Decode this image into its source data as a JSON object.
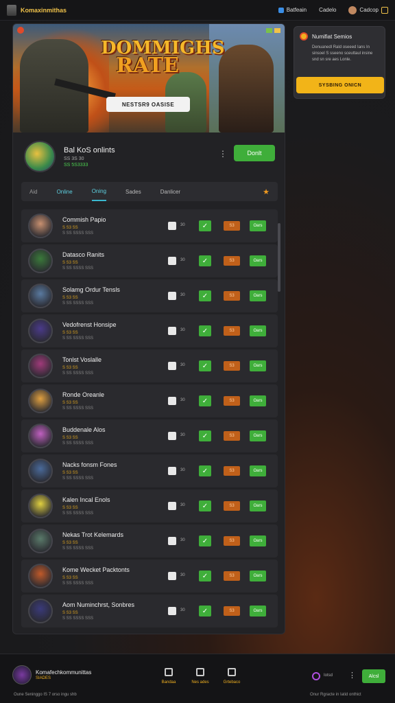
{
  "topbar": {
    "brand": "Komaxinmithas",
    "item1": "Batfeain",
    "item2": "Cadelo",
    "item3": "Cadcop"
  },
  "hero": {
    "title_line1": "DOMMIGHS",
    "title_line2": "RATE",
    "button": "NESTSR9 OASISE"
  },
  "profile": {
    "name": "Bal KoS onlints",
    "meta": "SS 3S 30",
    "stat": "SS 5S3333",
    "button": "Donlt"
  },
  "tabs": [
    "Aid",
    "Online",
    "Oning",
    "Sades",
    "Danlicer"
  ],
  "rows": [
    {
      "name": "Commish Papio",
      "sub": "S S3 SS",
      "sub2": "S SS SSSS SSS",
      "num": "30",
      "orange": "S3",
      "green": "Oars",
      "color": "#c89070"
    },
    {
      "name": "Datasco Ranits",
      "sub": "S S3 SS",
      "sub2": "S SS SSSS SSS",
      "num": "30",
      "orange": "S3",
      "green": "Oars",
      "color": "#3a7a3a"
    },
    {
      "name": "Solamg Ordur Tensls",
      "sub": "S S3 SS",
      "sub2": "S SS SSSS SSS",
      "num": "30",
      "orange": "S3",
      "green": "Oars",
      "color": "#5a7aa0"
    },
    {
      "name": "Vedofrenst Honsipe",
      "sub": "S S3 SS",
      "sub2": "S SS SSSS SSS",
      "num": "30",
      "orange": "S3",
      "green": "Oars",
      "color": "#4a3a8a"
    },
    {
      "name": "Tonlst Voslalle",
      "sub": "S S3 SS",
      "sub2": "S SS SSSS SSS",
      "num": "30",
      "orange": "S3",
      "green": "Oars",
      "color": "#a03a7a"
    },
    {
      "name": "Ronde Oreanle",
      "sub": "S S3 SS",
      "sub2": "S SS SSSS SSS",
      "num": "30",
      "orange": "S3",
      "green": "Oars",
      "color": "#e0a040"
    },
    {
      "name": "Buddenale Alos",
      "sub": "S S3 SS",
      "sub2": "S SS SSSS SSS",
      "num": "30",
      "orange": "S3",
      "green": "Oars",
      "color": "#c060c0"
    },
    {
      "name": "Nacks fonsm Fones",
      "sub": "S S3 SS",
      "sub2": "S SS SSSS SSS",
      "num": "30",
      "orange": "S3",
      "green": "Oars",
      "color": "#4a6a9a"
    },
    {
      "name": "Kalen Incal Enols",
      "sub": "S S3 SS",
      "sub2": "S SS SSSS SSS",
      "num": "30",
      "orange": "S3",
      "green": "Oars",
      "color": "#e0d040"
    },
    {
      "name": "Nekas Trot Kelemards",
      "sub": "S S3 SS",
      "sub2": "S SS SSSS SSS",
      "num": "30",
      "orange": "S3",
      "green": "Oars",
      "color": "#5a7a6a"
    },
    {
      "name": "Kome Wecket Packtonts",
      "sub": "S S3 SS",
      "sub2": "S SS SSSS SSS",
      "num": "30",
      "orange": "S3",
      "green": "Oars",
      "color": "#c05a2a"
    },
    {
      "name": "Aom Numinchrst, Sonbres",
      "sub": "S S3 SS",
      "sub2": "S SS SSSS SSS",
      "num": "30",
      "orange": "S3",
      "green": "Oars",
      "color": "#3a3a7a"
    }
  ],
  "note": {
    "title": "Numifiat Semios",
    "text": "Denuanedl Rald oseeed Ians In sinsoel S sseeno sceuttaul insine snd sn sre aes Lonle.",
    "button": "SYSBING ONICN"
  },
  "bottombar": {
    "name": "Komafechkommunittas",
    "sub": "SIADES",
    "foot": "Oune Seninggo IS 7 orso ingu shb",
    "nav": [
      "Bandaa",
      "Nes ades",
      "Grtebaco"
    ],
    "time": "Iotsd",
    "button": "Alcsl",
    "foot_right": "Onur Rgracte in Iatid onthict"
  }
}
